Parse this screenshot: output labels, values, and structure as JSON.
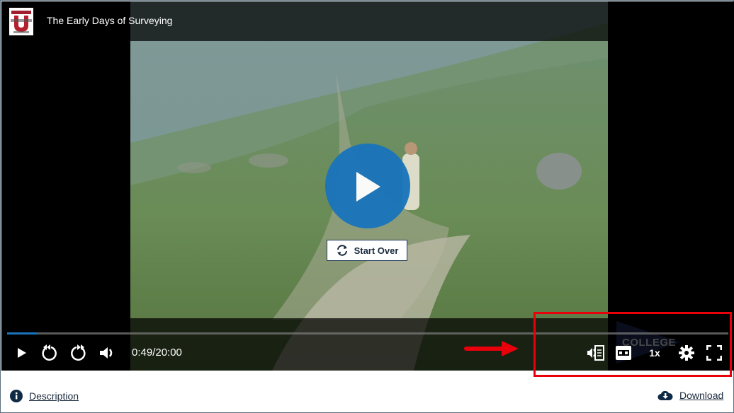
{
  "player": {
    "title": "The Early Days of Surveying",
    "logo_label": "Other U logo",
    "start_over_label": "Start Over",
    "time_display": "0:49/20:00",
    "progress_fraction": 0.041,
    "speed_label": "1x",
    "watermark": "COLLEGE",
    "accent_color": "#1a75bb",
    "controls": {
      "play": "play-icon",
      "rewind": "rewind-10-icon",
      "forward": "forward-10-icon",
      "volume": "volume-icon",
      "transcript": "audio-description-icon",
      "captions": "cc-icon",
      "settings": "gear-icon",
      "fullscreen": "fullscreen-icon"
    }
  },
  "annotation": {
    "highlight_color": "#e8000b"
  },
  "footer": {
    "description_label": "Description",
    "download_label": "Download"
  }
}
